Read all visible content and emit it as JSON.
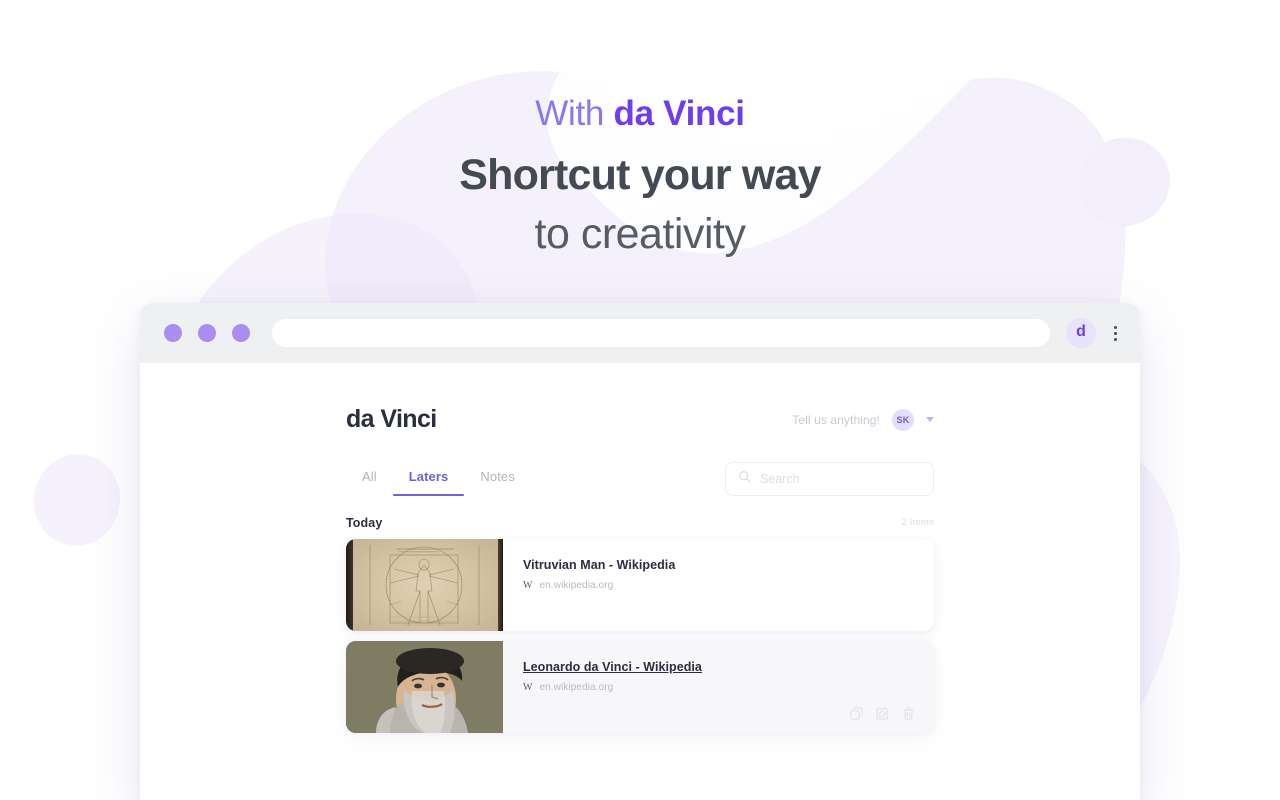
{
  "hero": {
    "eyebrow_prefix": "With ",
    "eyebrow_brand": "da Vinci",
    "line1": "Shortcut your way",
    "line2": "to creativity"
  },
  "browser": {
    "traffic_lights": [
      "dot-1",
      "dot-2",
      "dot-3"
    ],
    "url_value": "",
    "url_placeholder": "",
    "extension_badge_label": "d",
    "menu_icon": "kebab-menu-icon"
  },
  "app": {
    "logo": "da Vinci",
    "header": {
      "feedback_label": "Tell us anything!",
      "avatar_initials": "SK",
      "caret_icon": "chevron-down-icon"
    },
    "tabs": [
      {
        "label": "All",
        "active": false
      },
      {
        "label": "Laters",
        "active": true
      },
      {
        "label": "Notes",
        "active": false
      }
    ],
    "search": {
      "icon": "search-icon",
      "placeholder": "Search",
      "value": ""
    },
    "list": {
      "group_label": "Today",
      "count_label": "2 Items",
      "items": [
        {
          "title": "Vitruvian Man - Wikipedia",
          "favicon_glyph": "W",
          "source": "en.wikipedia.org",
          "thumbnail": "vitruvian-man-drawing",
          "hovered": false
        },
        {
          "title": "Leonardo da Vinci - Wikipedia",
          "favicon_glyph": "W",
          "source": "en.wikipedia.org",
          "thumbnail": "leonardo-da-vinci-portrait",
          "hovered": true
        }
      ],
      "actions": [
        {
          "name": "copy-icon",
          "label": "Copy"
        },
        {
          "name": "edit-icon",
          "label": "Edit"
        },
        {
          "name": "delete-icon",
          "label": "Delete"
        }
      ]
    }
  },
  "colors": {
    "accent": "#6C63D8",
    "brand_purple": "#6F3DF0",
    "eyebrow_light": "#8B78F0",
    "heading_dark": "#434A54",
    "dot_purple": "#A98EF0",
    "chrome_gray": "#EEF0F2",
    "card_hover": "#F7F7F9",
    "muted_text": "#B9B9C4",
    "blob_lavender": "#F3EFFC"
  }
}
